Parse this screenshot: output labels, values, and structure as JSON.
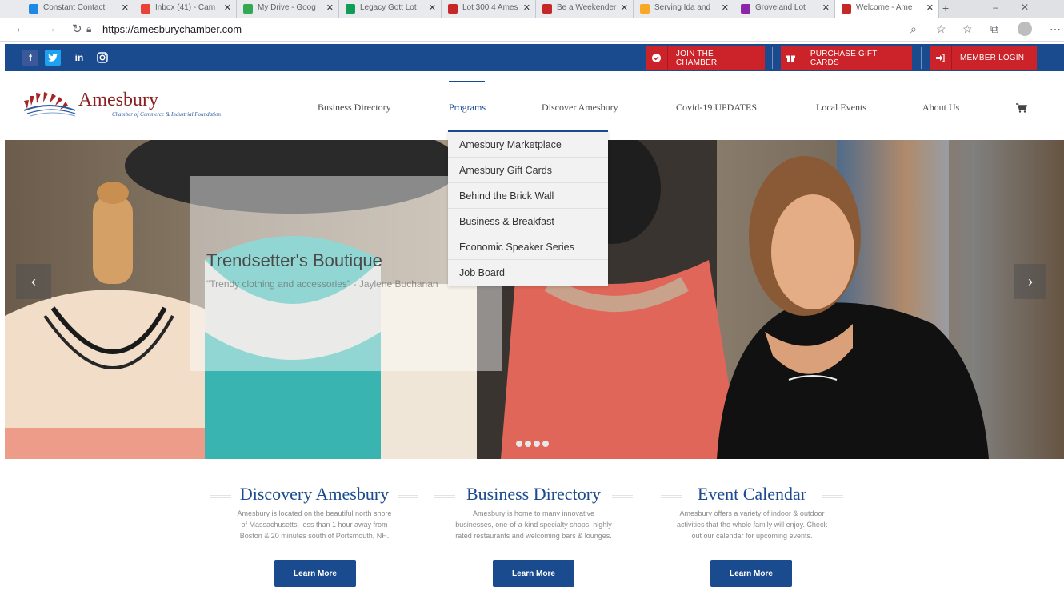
{
  "browser": {
    "tabs": [
      {
        "label": "Constant Contact",
        "color": "#1e88e5"
      },
      {
        "label": "Inbox (41) - Cam",
        "color": "#ea4335"
      },
      {
        "label": "My Drive - Goog",
        "color": "#34a853"
      },
      {
        "label": "Legacy Gott Lot",
        "color": "#0f9d58"
      },
      {
        "label": "Lot 300 4 Ames",
        "color": "#c62828"
      },
      {
        "label": "Be a Weekender",
        "color": "#c62828"
      },
      {
        "label": "Serving Ida and",
        "color": "#f9a825"
      },
      {
        "label": "Groveland Lot",
        "color": "#8e24aa"
      },
      {
        "label": "Welcome - Ame",
        "color": "#c62828"
      }
    ],
    "url": "https://amesburychamber.com"
  },
  "topbar": {
    "social": [
      "f",
      "t",
      "in",
      "ig"
    ],
    "buttons": [
      {
        "label": "JOIN THE CHAMBER",
        "icon": "check-circle-icon"
      },
      {
        "label": "PURCHASE GIFT CARDS",
        "icon": "gift-icon"
      },
      {
        "label": "MEMBER LOGIN",
        "icon": "sign-in-icon"
      }
    ]
  },
  "logo": {
    "name": "Amesbury",
    "subtitle": "Chamber of Commerce & Industrial Foundation"
  },
  "menu": [
    {
      "label": "Business Directory"
    },
    {
      "label": "Programs"
    },
    {
      "label": "Discover Amesbury"
    },
    {
      "label": "Covid-19 UPDATES"
    },
    {
      "label": "Local Events"
    },
    {
      "label": "About Us"
    }
  ],
  "programs_dropdown": [
    "Amesbury Marketplace",
    "Amesbury Gift Cards",
    "Behind the Brick Wall",
    "Business & Breakfast",
    "Economic Speaker Series",
    "Job Board"
  ],
  "hero": {
    "title": "Trendsetter's Boutique",
    "quote": "\"Trendy clothing and accessories\" - Jaylene Buchanan"
  },
  "features": [
    {
      "title": "Discovery Amesbury",
      "lines": [
        "Amesbury is located on the beautiful north shore",
        "of Massachusetts, less than 1 hour away from",
        "Boston & 20 minutes south of Portsmouth, NH."
      ],
      "button": "Learn More"
    },
    {
      "title": "Business Directory",
      "lines": [
        "Amesbury is home to many innovative",
        "businesses, one-of-a-kind specialty shops, highly",
        "rated restaurants and welcoming bars & lounges."
      ],
      "button": "Learn More"
    },
    {
      "title": "Event Calendar",
      "lines": [
        "Amesbury offers a variety of indoor & outdoor",
        "activities that the whole family will enjoy. Check",
        "out our calendar for upcoming events."
      ],
      "button": "Learn More"
    }
  ],
  "colors": {
    "brand_blue": "#1b4b8f",
    "cta_red": "#cc2229",
    "logo_red": "#8a1f1f"
  }
}
